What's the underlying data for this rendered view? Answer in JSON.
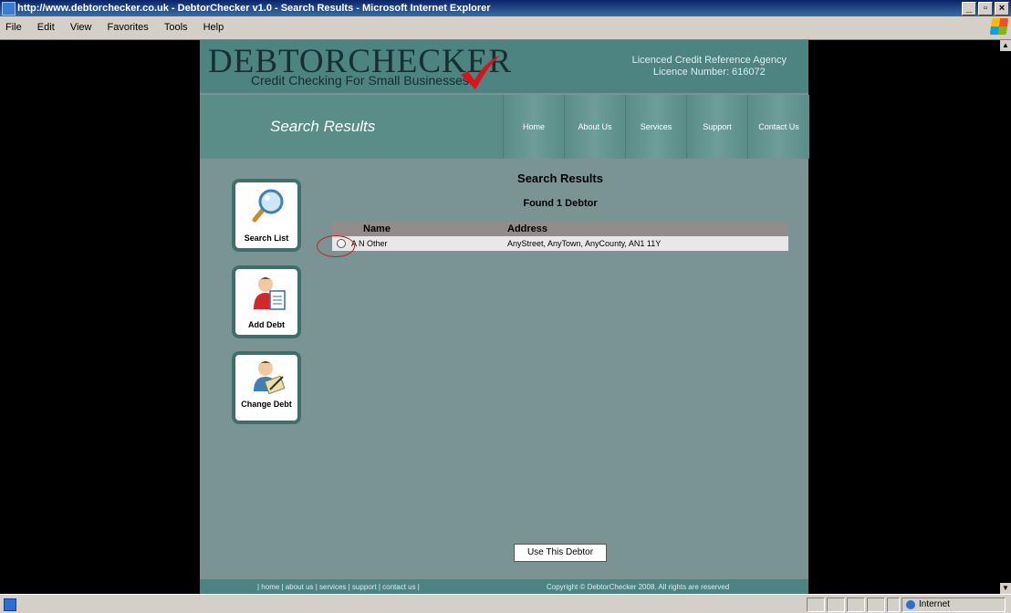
{
  "window": {
    "title": "http://www.debtorchecker.co.uk - DebtorChecker v1.0 - Search Results - Microsoft Internet Explorer",
    "controls": [
      "_",
      "▫",
      "×"
    ]
  },
  "menu": [
    "File",
    "Edit",
    "View",
    "Favorites",
    "Tools",
    "Help"
  ],
  "header": {
    "logo": "DEBTORCHECKER",
    "tagline": "Credit Checking For Small Businesses",
    "agency_line1": "Licenced Credit Reference Agency",
    "agency_line2": "Licence Number: 616072"
  },
  "nav": {
    "title": "Search Results",
    "items": [
      "Home",
      "About Us",
      "Services",
      "Support",
      "Contact Us"
    ]
  },
  "sidebar": {
    "buttons": [
      {
        "label": "Search List",
        "icon": "magnifier-icon"
      },
      {
        "label": "Add Debt",
        "icon": "person-document-icon"
      },
      {
        "label": "Change Debt",
        "icon": "person-pen-icon"
      }
    ]
  },
  "content": {
    "title": "Search Results",
    "found": "Found 1 Debtor",
    "columns": [
      "Name",
      "Address"
    ],
    "rows": [
      {
        "name": "A N Other",
        "address": "AnyStreet, AnyTown, AnyCounty, AN1 11Y",
        "selected": false
      }
    ],
    "use_button": "Use This Debtor"
  },
  "footer": {
    "links": "| home | about us | services | support | contact us |",
    "copyright": "Copyright © DebtorChecker 2008. All rights are reserved"
  },
  "status": {
    "zone": "Internet"
  },
  "colors": {
    "header_teal": "#4d8380",
    "nav_teal": "#5a8c88",
    "content_bg": "#7a9393",
    "check_red": "#d8141a"
  }
}
